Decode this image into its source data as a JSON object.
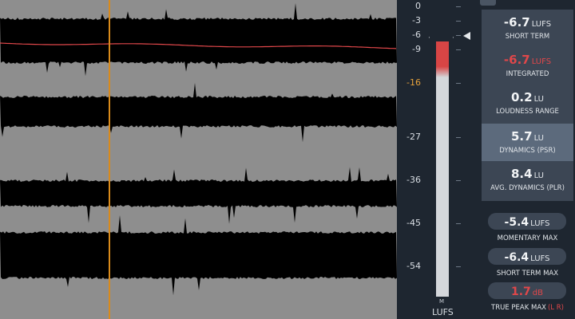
{
  "meter": {
    "scale": [
      {
        "label": "0",
        "orange": false
      },
      {
        "label": "-3",
        "orange": false
      },
      {
        "label": "-6",
        "orange": false
      },
      {
        "label": "-9",
        "orange": false
      },
      {
        "label": "-16",
        "orange": true
      },
      {
        "label": "-27",
        "orange": false
      },
      {
        "label": "-36",
        "orange": false
      },
      {
        "label": "-45",
        "orange": false
      },
      {
        "label": "-54",
        "orange": false
      }
    ],
    "bar_caption": "M",
    "unit_label": "LUFS",
    "red_fraction": 0.14
  },
  "stats": {
    "short_term": {
      "value": "-6.7",
      "unit": "LUFS",
      "caption": "SHORT TERM"
    },
    "integrated": {
      "value": "-6.7",
      "unit": "LUFS",
      "caption": "INTEGRATED"
    },
    "loudness_range": {
      "value": "0.2",
      "unit": "LU",
      "caption": "LOUDNESS RANGE"
    },
    "dynamics_psr": {
      "value": "5.7",
      "unit": "LU",
      "caption": "DYNAMICS (PSR)"
    },
    "avg_dynamics_plr": {
      "value": "8.4",
      "unit": "LU",
      "caption": "AVG. DYNAMICS (PLR)"
    },
    "momentary_max": {
      "value": "-5.4",
      "unit": "LUFS",
      "caption": "MOMENTARY MAX"
    },
    "short_term_max": {
      "value": "-6.4",
      "unit": "LUFS",
      "caption": "SHORT TERM MAX"
    },
    "true_peak_max": {
      "value": "1.7",
      "unit": "dB",
      "caption": "TRUE PEAK MAX",
      "channels": "(L R)"
    }
  },
  "colors": {
    "accent_red": "#e0474a",
    "playhead": "#d98a1a",
    "panel_bg": "#1e2630",
    "card_bg": "#3c4654"
  }
}
